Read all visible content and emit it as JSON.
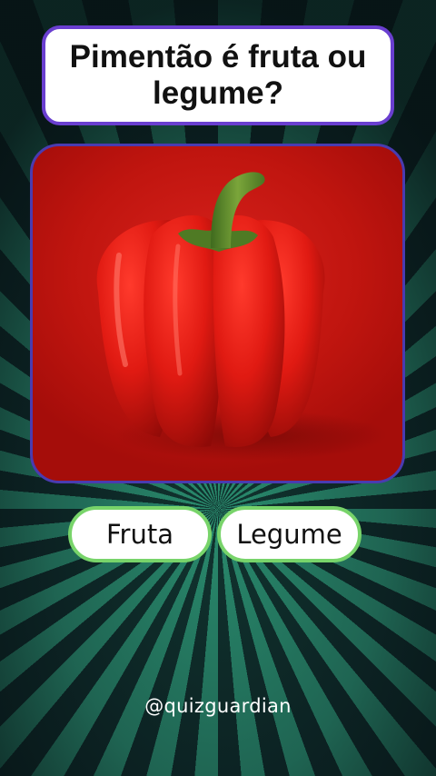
{
  "quiz": {
    "question": "Pimentão é fruta ou legume?",
    "image": "red-bell-pepper",
    "answers": [
      {
        "label": "Fruta"
      },
      {
        "label": "Legume"
      }
    ]
  },
  "footer": {
    "handle": "@quizguardian"
  },
  "colors": {
    "question_border": "#6a3fd0",
    "answer_border": "#78d46a",
    "image_background": "#c0150f",
    "pepper": "#e01a12",
    "stem": "#5e8f2e",
    "ray_light": "#2a8a6d",
    "ray_dark": "#0d2424"
  }
}
